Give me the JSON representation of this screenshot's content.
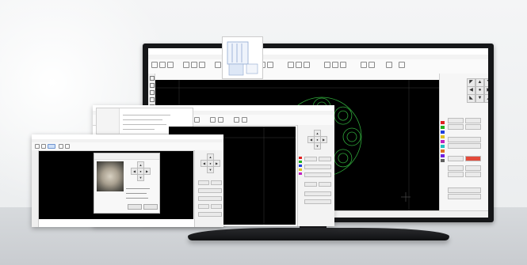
{
  "scene": {
    "background": "#eef0f1",
    "floor_color": "#cfd2d5"
  },
  "monitor_app": {
    "window_title": "",
    "menu": [
      "",
      "",
      "",
      "",
      "",
      ""
    ],
    "ribbon_groups": [
      "",
      "",
      "",
      "",
      "",
      "",
      "",
      "",
      "",
      "",
      "",
      "",
      "",
      ""
    ],
    "canvas": {
      "background": "#000000",
      "pattern_color": "#2fa83a"
    },
    "status_items": [
      "",
      "",
      ""
    ]
  },
  "mid_app": {
    "window_title": ""
  },
  "front_app": {
    "window_title": ""
  },
  "colors": {
    "panel_bg": "#f6f6f6",
    "layer_red": "#e02020",
    "layer_green": "#20b020",
    "layer_blue": "#2040e0",
    "layer_yellow": "#e0c020",
    "layer_magenta": "#c020c0",
    "layer_cyan": "#20c0c0"
  }
}
